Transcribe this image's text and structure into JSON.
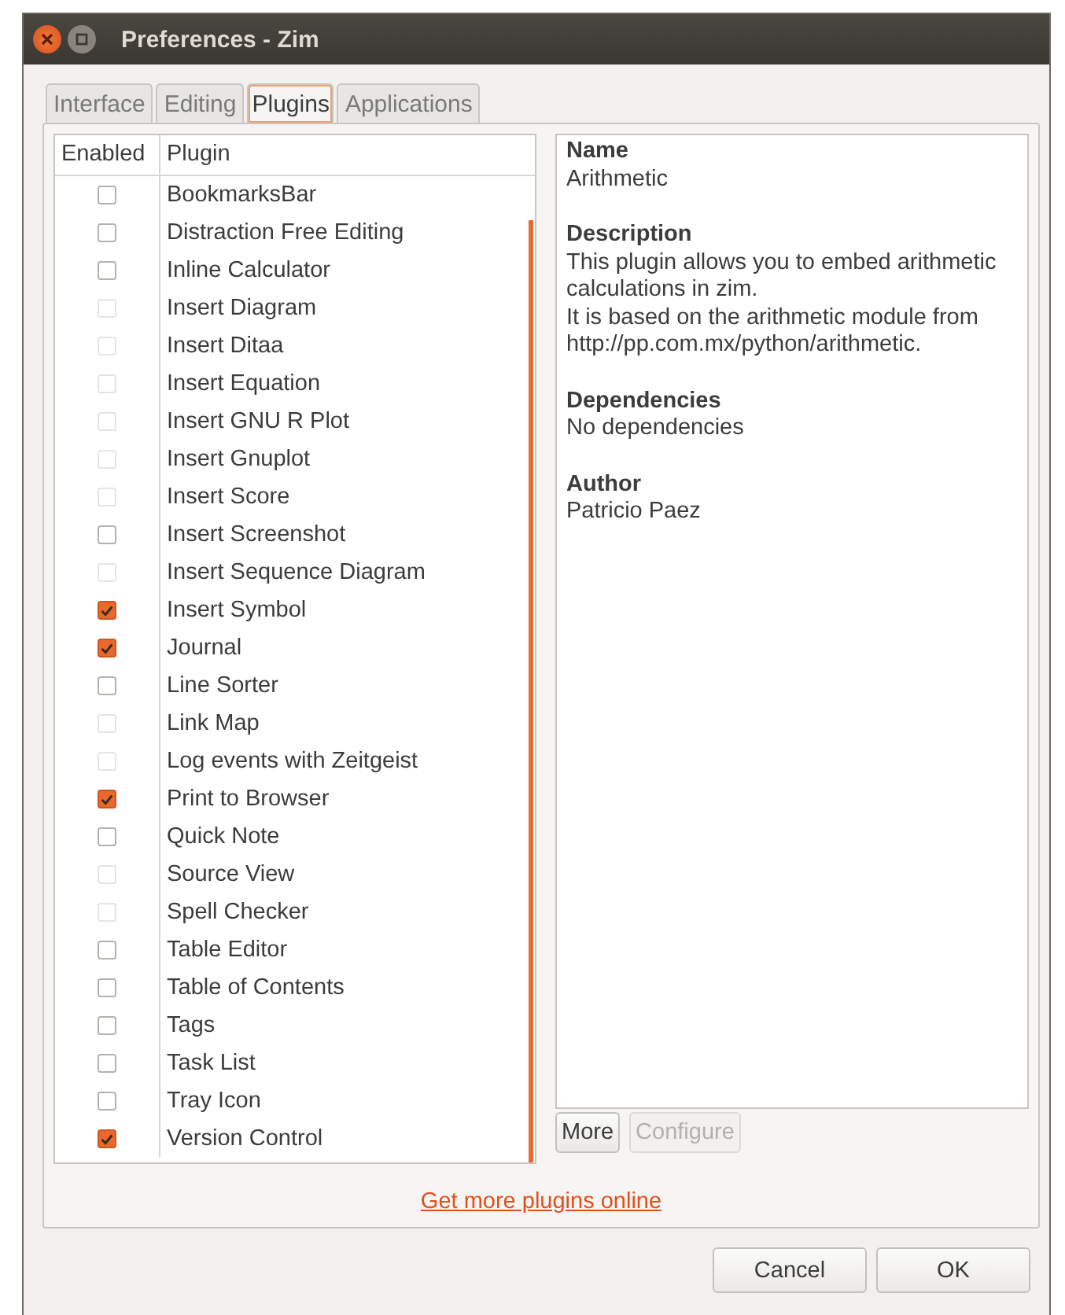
{
  "window": {
    "title": "Preferences - Zim"
  },
  "tabs": [
    {
      "label": "Interface",
      "selected": false
    },
    {
      "label": "Editing",
      "selected": false
    },
    {
      "label": "Plugins",
      "selected": true
    },
    {
      "label": "Applications",
      "selected": false
    }
  ],
  "plugin_table": {
    "columns": [
      "Enabled",
      "Plugin"
    ],
    "rows": [
      {
        "name": "BookmarksBar",
        "checked": false,
        "disabled": false
      },
      {
        "name": "Distraction Free Editing",
        "checked": false,
        "disabled": false
      },
      {
        "name": "Inline Calculator",
        "checked": false,
        "disabled": false
      },
      {
        "name": "Insert Diagram",
        "checked": false,
        "disabled": true
      },
      {
        "name": "Insert Ditaa",
        "checked": false,
        "disabled": true
      },
      {
        "name": "Insert Equation",
        "checked": false,
        "disabled": true
      },
      {
        "name": "Insert GNU R Plot",
        "checked": false,
        "disabled": true
      },
      {
        "name": "Insert Gnuplot",
        "checked": false,
        "disabled": true
      },
      {
        "name": "Insert Score",
        "checked": false,
        "disabled": true
      },
      {
        "name": "Insert Screenshot",
        "checked": false,
        "disabled": false
      },
      {
        "name": "Insert Sequence Diagram",
        "checked": false,
        "disabled": true
      },
      {
        "name": "Insert Symbol",
        "checked": true,
        "disabled": false
      },
      {
        "name": "Journal",
        "checked": true,
        "disabled": false
      },
      {
        "name": "Line Sorter",
        "checked": false,
        "disabled": false
      },
      {
        "name": "Link Map",
        "checked": false,
        "disabled": true
      },
      {
        "name": "Log events with Zeitgeist",
        "checked": false,
        "disabled": true
      },
      {
        "name": "Print to Browser",
        "checked": true,
        "disabled": false
      },
      {
        "name": "Quick Note",
        "checked": false,
        "disabled": false
      },
      {
        "name": "Source View",
        "checked": false,
        "disabled": true
      },
      {
        "name": "Spell Checker",
        "checked": false,
        "disabled": true
      },
      {
        "name": "Table Editor",
        "checked": false,
        "disabled": false
      },
      {
        "name": "Table of Contents",
        "checked": false,
        "disabled": false
      },
      {
        "name": "Tags",
        "checked": false,
        "disabled": false
      },
      {
        "name": "Task List",
        "checked": false,
        "disabled": false
      },
      {
        "name": "Tray Icon",
        "checked": false,
        "disabled": false
      },
      {
        "name": "Version Control",
        "checked": true,
        "disabled": false
      }
    ]
  },
  "details": [
    {
      "heading": "Name",
      "text": "Arithmetic"
    },
    {
      "heading": "Description",
      "text": "This plugin allows you to embed arithmetic calculations in zim.\nIt is based on the arithmetic module from http://pp.com.mx/python/arithmetic."
    },
    {
      "heading": "Dependencies",
      "text": "No dependencies"
    },
    {
      "heading": "Author",
      "text": "Patricio Paez"
    }
  ],
  "plugin_buttons": [
    {
      "label": "More",
      "disabled": false
    },
    {
      "label": "Configure",
      "disabled": true
    }
  ],
  "link": "Get more plugins online",
  "dialog_buttons": [
    "Cancel",
    "OK"
  ]
}
